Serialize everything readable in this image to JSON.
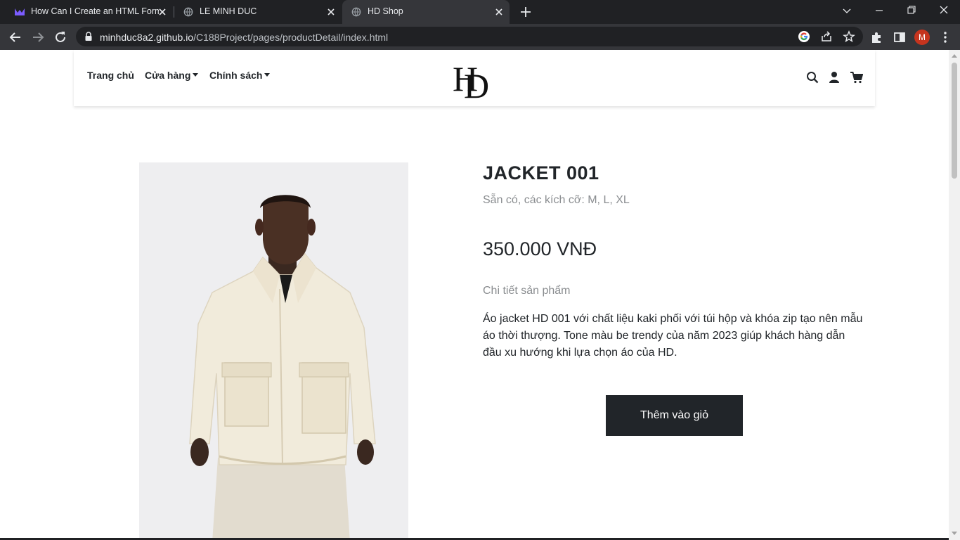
{
  "browser": {
    "tabs": [
      {
        "title": "How Can I Create an HTML Form",
        "favicon": "monday-icon",
        "active": false
      },
      {
        "title": "LE MINH DUC",
        "favicon": "globe-icon",
        "active": false
      },
      {
        "title": "HD Shop",
        "favicon": "globe-icon",
        "active": true
      }
    ],
    "url_host": "minhduc8a2.github.io",
    "url_path": "/C188Project/pages/productDetail/index.html",
    "profile_initial": "M"
  },
  "nav": {
    "home": "Trang chủ",
    "shop": "Cửa hàng",
    "policy": "Chính sách",
    "logo_text": "HD"
  },
  "product": {
    "name": "JACKET 001",
    "availability": "Sẵn có, các kích cỡ: M, L, XL",
    "price": "350.000 VNĐ",
    "detail_label": "Chi tiết sản phẩm",
    "description": "Áo jacket HD 001 với chất liệu kaki phối với túi hộp và khóa zip tạo nên mẫu áo thời thượng. Tone màu be trendy của năm 2023 giúp khách hàng dẫn đầu xu hướng khi lựa chọn áo của HD.",
    "add_to_cart": "Thêm vào giỏ"
  },
  "colors": {
    "chrome_dark": "#202124",
    "chrome_toolbar": "#35363a",
    "text_dark": "#212529",
    "text_muted": "#8a8d90",
    "button_bg": "#212529",
    "jacket": "#f1ebdb"
  }
}
